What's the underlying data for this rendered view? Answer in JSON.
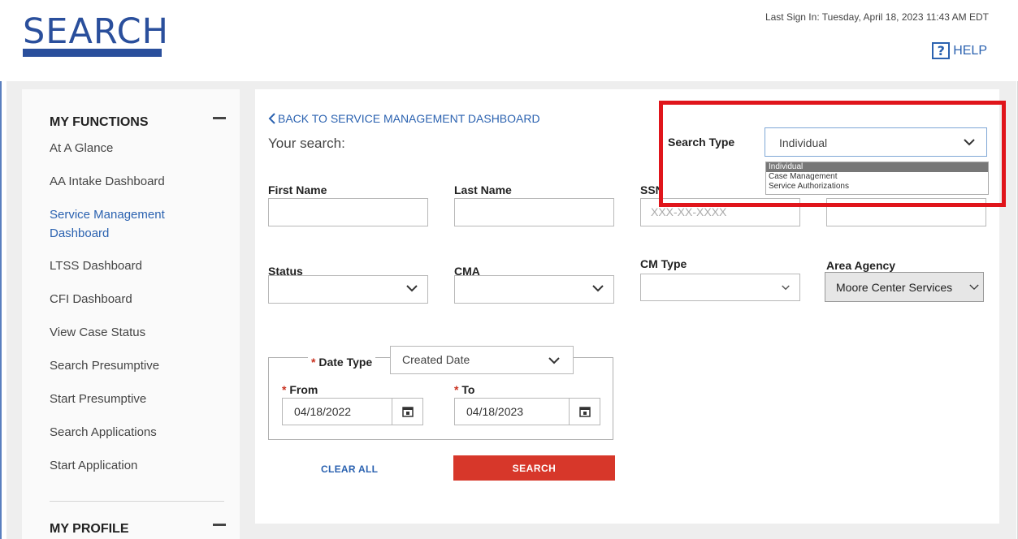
{
  "header": {
    "logo": "SEARCH",
    "last_signin": "Last Sign In: Tuesday, April 18, 2023 11:43 AM EDT",
    "help_label": "HELP",
    "help_icon_glyph": "?"
  },
  "sidebar": {
    "section_title": "MY FUNCTIONS",
    "items": [
      {
        "label": "At A Glance"
      },
      {
        "label": "AA Intake Dashboard"
      },
      {
        "label": "Service Management Dashboard"
      },
      {
        "label": "LTSS Dashboard"
      },
      {
        "label": "CFI Dashboard"
      },
      {
        "label": "View Case Status"
      },
      {
        "label": "Search Presumptive"
      },
      {
        "label": "Start Presumptive"
      },
      {
        "label": "Search Applications"
      },
      {
        "label": "Start Application"
      }
    ],
    "profile_title": "MY PROFILE"
  },
  "main": {
    "back_link": "BACK TO SERVICE MANAGEMENT DASHBOARD",
    "your_search": "Your search:",
    "search_type": {
      "label": "Search Type",
      "value": "Individual",
      "options": [
        "Individual",
        "Case Management",
        "Service Authorizations"
      ]
    },
    "first_name": {
      "label": "First Name",
      "value": ""
    },
    "last_name": {
      "label": "Last Name",
      "value": ""
    },
    "ssn": {
      "label": "SSN",
      "placeholder": "XXX-XX-XXXX"
    },
    "fourth_field": {
      "value": ""
    },
    "status": {
      "label": "Status",
      "value": ""
    },
    "cma": {
      "label": "CMA",
      "value": ""
    },
    "cm_type": {
      "label": "CM Type",
      "value": ""
    },
    "area_agency": {
      "label": "Area Agency",
      "value": "Moore Center Services"
    },
    "date_type": {
      "label": "Date Type",
      "value": "Created Date"
    },
    "from": {
      "label": "From",
      "value": "04/18/2022"
    },
    "to": {
      "label": "To",
      "value": "04/18/2023"
    },
    "required_mark": "*",
    "clear_all": "CLEAR ALL",
    "search_button": "SEARCH"
  },
  "colors": {
    "brand_blue": "#2a4f9c",
    "link_blue": "#2b62b0",
    "search_red": "#d7372a",
    "highlight_red": "#e0151b"
  },
  "icons": {
    "minus": "minus-icon",
    "chevron": "chevron-down-icon",
    "calendar": "calendar-icon",
    "back": "chevron-left-icon",
    "help": "help-icon"
  }
}
